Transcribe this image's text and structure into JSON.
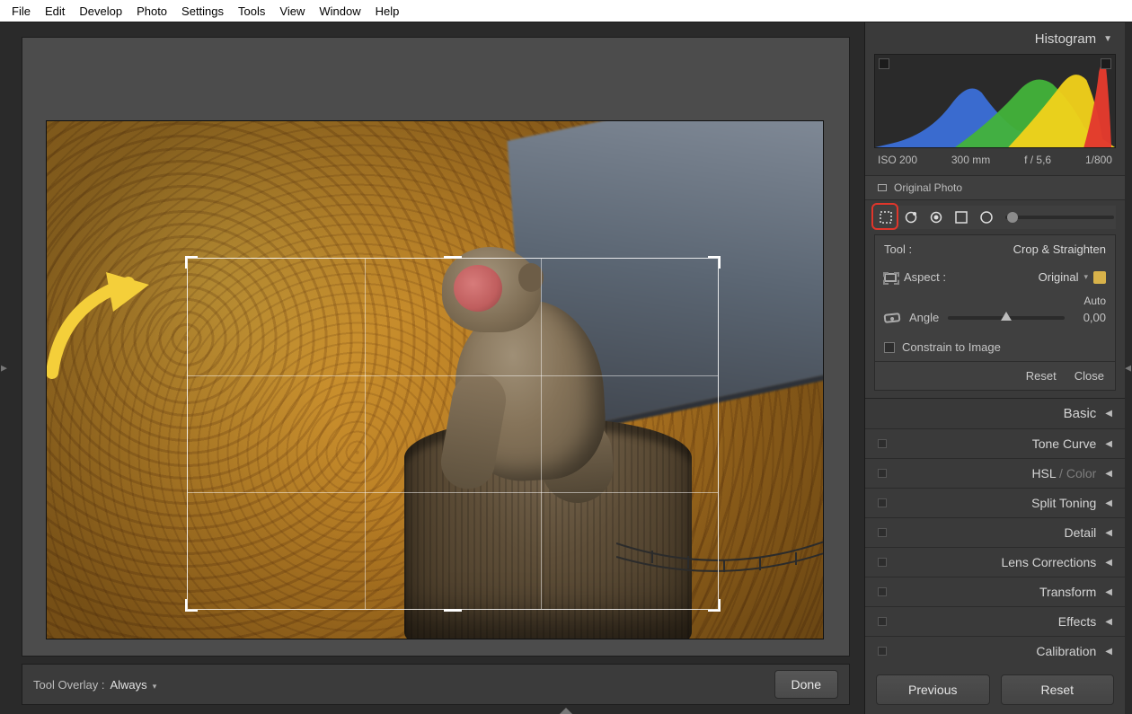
{
  "menu": {
    "items": [
      "File",
      "Edit",
      "Develop",
      "Photo",
      "Settings",
      "Tools",
      "View",
      "Window",
      "Help"
    ]
  },
  "right": {
    "histogram_title": "Histogram",
    "meta": {
      "iso": "ISO 200",
      "focal": "300 mm",
      "aperture": "f / 5,6",
      "shutter": "1/800"
    },
    "original_photo": "Original Photo",
    "tool_label": "Tool :",
    "tool_value": "Crop & Straighten",
    "aspect_label": "Aspect :",
    "aspect_value": "Original",
    "auto": "Auto",
    "angle_label": "Angle",
    "angle_value": "0,00",
    "constrain": "Constrain to Image",
    "reset": "Reset",
    "close": "Close",
    "panels": {
      "basic": "Basic",
      "tone_curve": "Tone Curve",
      "hsl": "HSL",
      "color": "Color",
      "split": "Split Toning",
      "detail": "Detail",
      "lens": "Lens Corrections",
      "transform": "Transform",
      "effects": "Effects",
      "calibration": "Calibration"
    },
    "previous": "Previous",
    "reset_footer": "Reset"
  },
  "bottom": {
    "overlay_label": "Tool Overlay :",
    "overlay_value": "Always",
    "done": "Done"
  }
}
